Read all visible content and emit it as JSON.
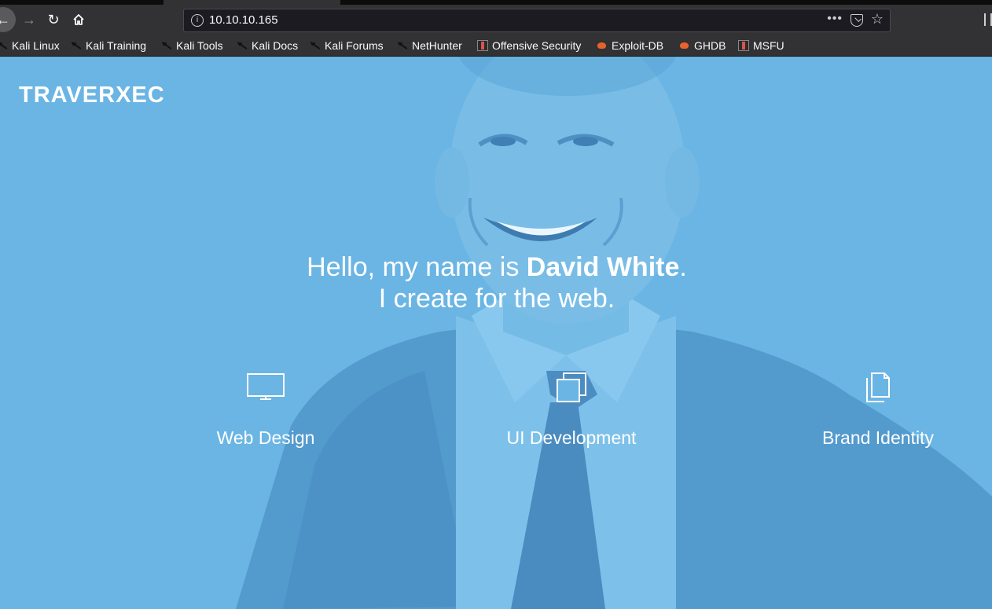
{
  "browser": {
    "url": "10.10.10.165",
    "bookmarks": [
      {
        "label": "Kali Linux",
        "icon": "kali-dragon-icon"
      },
      {
        "label": "Kali Training",
        "icon": "kali-dragon-icon"
      },
      {
        "label": "Kali Tools",
        "icon": "kali-dragon-icon"
      },
      {
        "label": "Kali Docs",
        "icon": "kali-dragon-icon"
      },
      {
        "label": "Kali Forums",
        "icon": "kali-dragon-icon"
      },
      {
        "label": "NetHunter",
        "icon": "kali-dragon-icon"
      },
      {
        "label": "Offensive Security",
        "icon": "offsec-icon"
      },
      {
        "label": "Exploit-DB",
        "icon": "exploit-db-icon"
      },
      {
        "label": "GHDB",
        "icon": "exploit-db-icon"
      },
      {
        "label": "MSFU",
        "icon": "offsec-icon"
      }
    ]
  },
  "site": {
    "brand": "TRAVERXEC",
    "hero": {
      "line1_prefix": "Hello, my name is ",
      "name": "David White",
      "line1_suffix": ".",
      "line2": "I create for the web."
    },
    "services": [
      {
        "label": "Web Design",
        "icon": "monitor-icon"
      },
      {
        "label": "UI Development",
        "icon": "layers-icon"
      },
      {
        "label": "Brand Identity",
        "icon": "documents-icon"
      }
    ]
  },
  "colors": {
    "page_background": "#6ab5e4",
    "chrome": "#323234",
    "text": "#ffffff"
  }
}
